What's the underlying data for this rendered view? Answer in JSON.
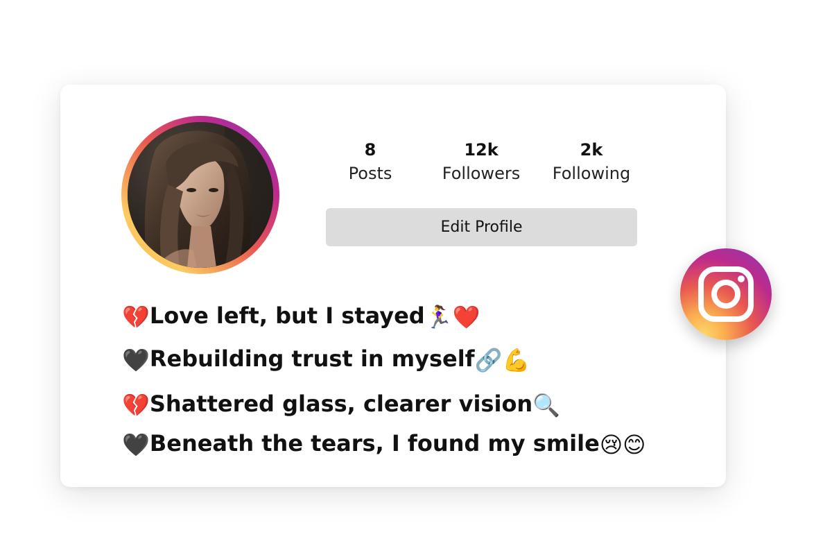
{
  "profile": {
    "avatar_alt": "profile photo"
  },
  "stats": [
    {
      "value": "8",
      "label": "Posts"
    },
    {
      "value": "12k",
      "label": "Followers"
    },
    {
      "value": "2k",
      "label": "Following"
    }
  ],
  "actions": {
    "edit_profile_label": "Edit Profile"
  },
  "bio": {
    "lines": [
      {
        "prefix": "💔",
        "text": "Love left, but I stayed",
        "suffix": "🏃‍♀️❤️"
      },
      {
        "prefix": "🖤 ",
        "text": "Rebuilding trust in myself",
        "suffix": "🔗💪"
      },
      {
        "prefix": "💔",
        "text": "Shattered glass, clearer vision",
        "suffix": "🔍"
      },
      {
        "prefix": "🖤 ",
        "text": "Beneath the tears, I found my smile",
        "suffix": "😢😊"
      }
    ]
  },
  "badge": {
    "icon": "instagram-logo-icon",
    "colors": {
      "purple": "#8a3ab9",
      "magenta": "#bc2a8d",
      "red": "#e95950",
      "orange": "#fbad50",
      "yellow": "#fccc63"
    }
  }
}
